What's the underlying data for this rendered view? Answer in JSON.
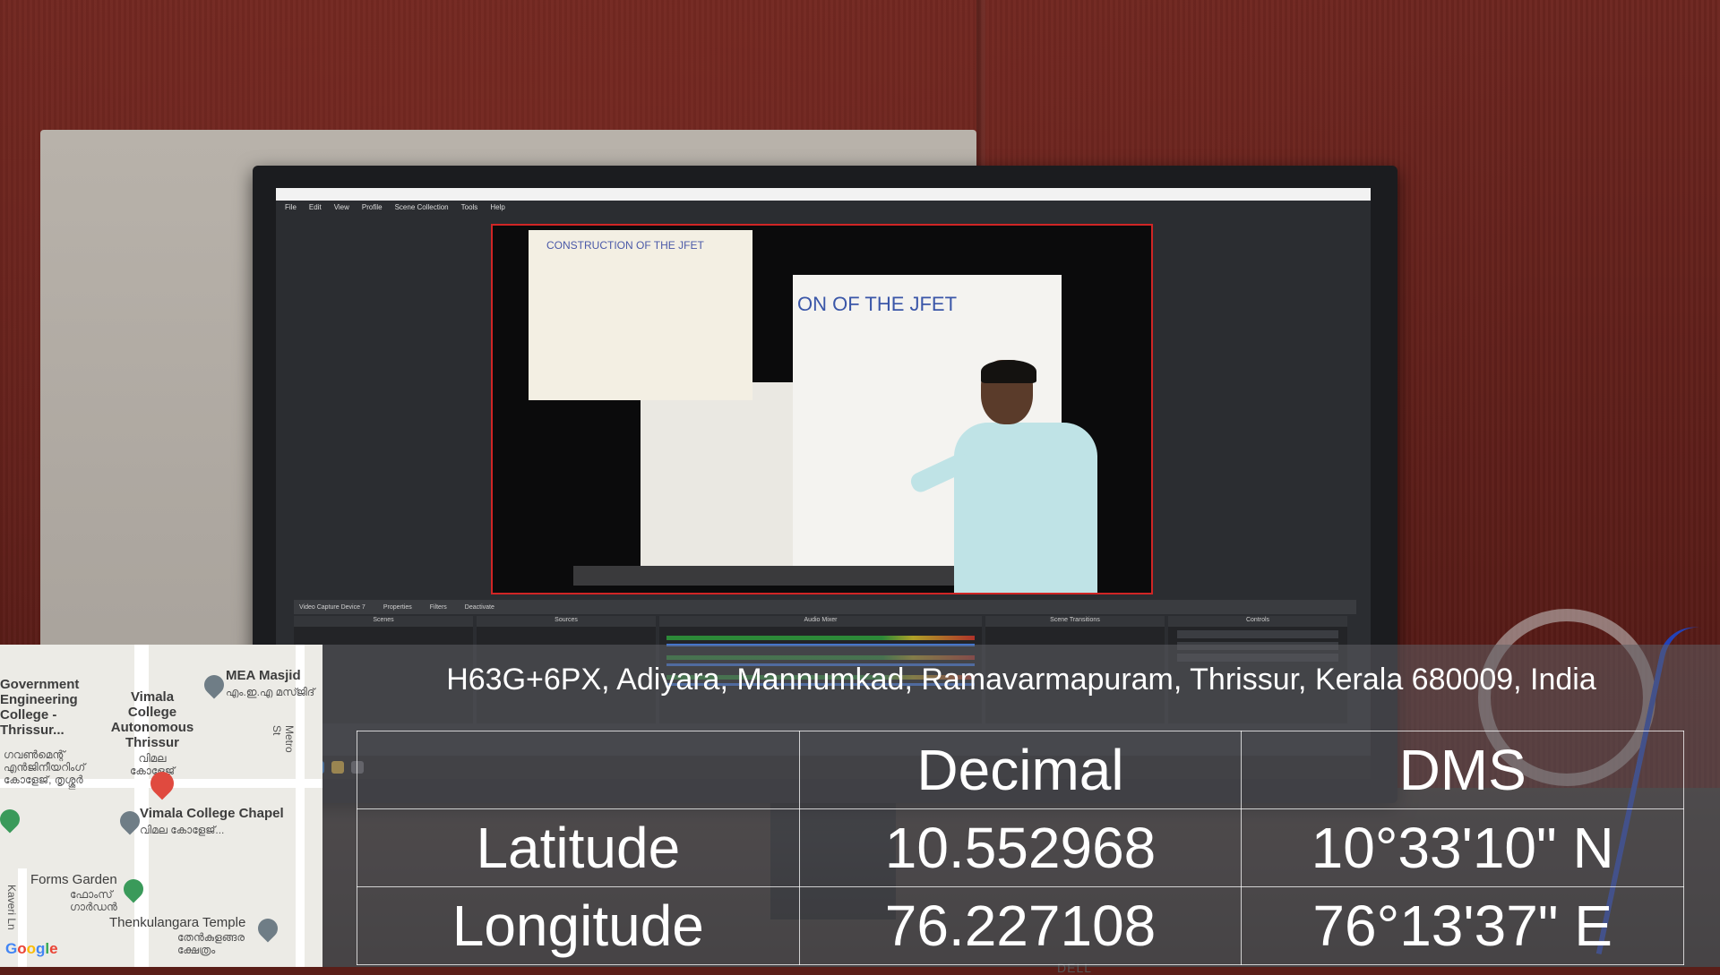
{
  "monitor": {
    "menu": [
      "File",
      "Edit",
      "View",
      "Profile",
      "Scene Collection",
      "Tools",
      "Help"
    ],
    "slide_title_small": "CONSTRUCTION OF THE JFET",
    "slide_title_large": "ON OF THE JFET",
    "properties_bar": {
      "source": "Video Capture Device 7",
      "properties": "Properties",
      "filters": "Filters",
      "deactivate": "Deactivate"
    },
    "docks": [
      "Scenes",
      "Sources",
      "Audio Mixer",
      "Scene Transitions",
      "Controls"
    ],
    "brand": "DELL"
  },
  "map": {
    "places": [
      {
        "name": "Government Engineering College - Thrissur...",
        "local": "ഗവൺമെന്റ് എൻജിനീയറിംഗ് കോളേജ്, തൃശ്ശൂർ"
      },
      {
        "name": "Vimala College Autonomous Thrissur",
        "local": "വിമല കോളേജ്"
      },
      {
        "name": "MEA Masjid",
        "local": "എം.ഇ.എ മസ്ജിദ്"
      },
      {
        "name": "Vimala College Chapel",
        "local": "വിമല കോളേജ്..."
      },
      {
        "name": "Forms Garden",
        "local": "ഫോംസ് ഗാർഡൻ"
      },
      {
        "name": "Thenkulangara Temple",
        "local": "തേൻകുളങ്ങര ക്ഷേത്രം"
      }
    ],
    "roads": [
      "Metro St",
      "Kaveri Ln"
    ],
    "logo": "Google"
  },
  "address": "H63G+6PX, Adiyara, Mannumkad, Ramavarmapuram, Thrissur, Kerala 680009, India",
  "coordinates": {
    "headers": [
      "",
      "Decimal",
      "DMS"
    ],
    "rows": [
      {
        "label": "Latitude",
        "decimal": "10.552968",
        "dms": "10°33'10\" N"
      },
      {
        "label": "Longitude",
        "decimal": "76.227108",
        "dms": "76°13'37\" E"
      }
    ]
  }
}
